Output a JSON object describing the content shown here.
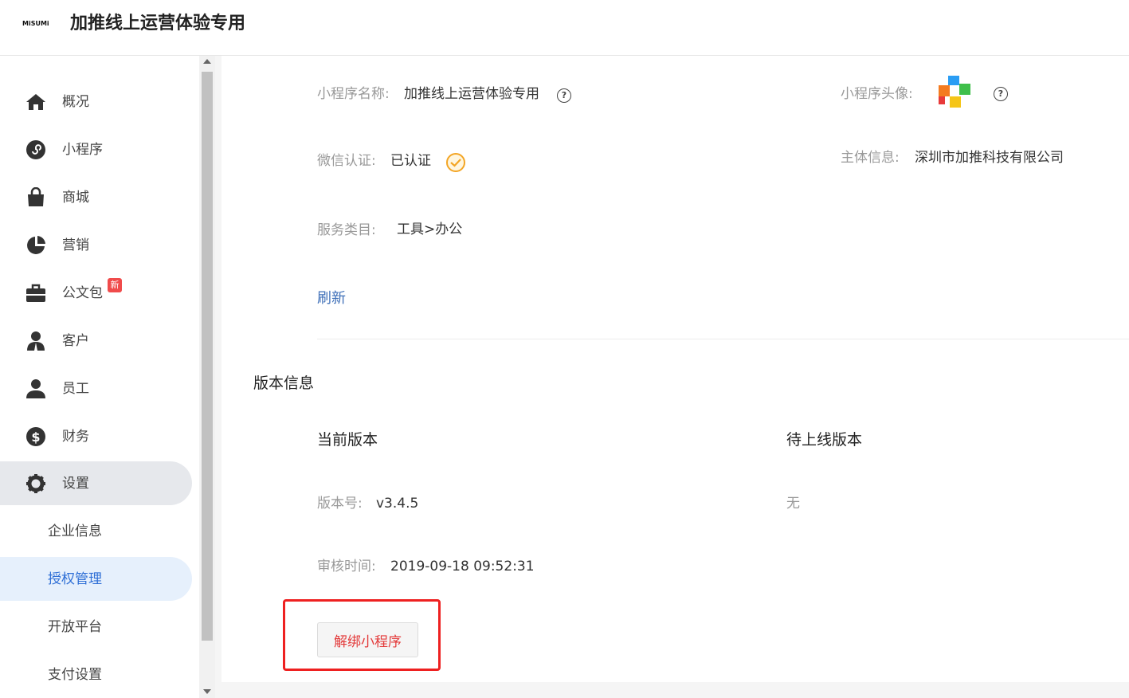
{
  "header": {
    "logo_text": "MiSUMi",
    "title": "加推线上运营体验专用"
  },
  "sidebar": {
    "items": [
      {
        "label": "概况",
        "icon": "home-icon"
      },
      {
        "label": "小程序",
        "icon": "miniprogram-icon"
      },
      {
        "label": "商城",
        "icon": "shopping-bag-icon"
      },
      {
        "label": "营销",
        "icon": "pie-chart-icon"
      },
      {
        "label": "公文包",
        "icon": "briefcase-icon",
        "badge": "新"
      },
      {
        "label": "客户",
        "icon": "customer-icon"
      },
      {
        "label": "员工",
        "icon": "user-icon"
      },
      {
        "label": "财务",
        "icon": "dollar-icon"
      },
      {
        "label": "设置",
        "icon": "gear-icon",
        "active": true
      }
    ],
    "sub_items": [
      {
        "label": "企业信息"
      },
      {
        "label": "授权管理",
        "selected": true
      },
      {
        "label": "开放平台"
      },
      {
        "label": "支付设置"
      }
    ]
  },
  "info": {
    "name_label": "小程序名称:",
    "name_value": "加推线上运营体验专用",
    "avatar_label": "小程序头像:",
    "wechat_label": "微信认证:",
    "wechat_value": "已认证",
    "entity_label": "主体信息:",
    "entity_value": "深圳市加推科技有限公司",
    "category_label": "服务类目:",
    "category_value": "工具>办公",
    "refresh_label": "刷新"
  },
  "version": {
    "section_title": "版本信息",
    "current_title": "当前版本",
    "pending_title": "待上线版本",
    "version_label": "版本号:",
    "version_value": "v3.4.5",
    "pending_value": "无",
    "review_label": "审核时间:",
    "review_value": "2019-09-18 09:52:31",
    "unbind_label": "解绑小程序"
  },
  "colors": {
    "accent": "#2f6fd6",
    "link": "#3e6fb8",
    "danger": "#e33a3a",
    "highlight": "#ee2020",
    "verified": "#f3a524"
  }
}
